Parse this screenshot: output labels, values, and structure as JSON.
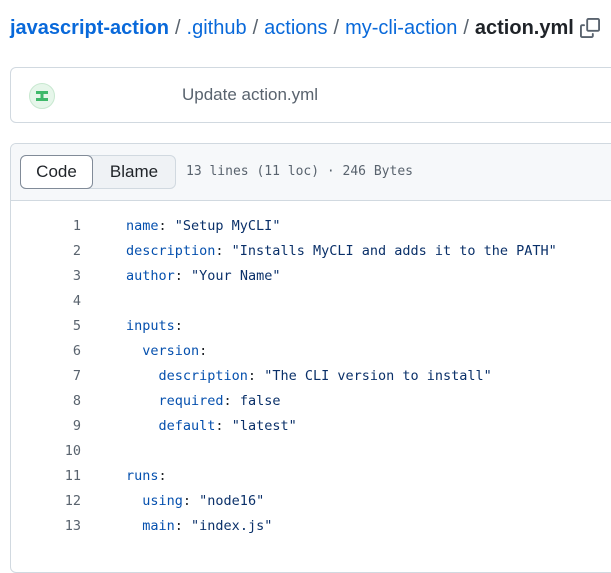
{
  "breadcrumb": {
    "repo": "javascript-action",
    "segments": [
      ".github",
      "actions",
      "my-cli-action"
    ],
    "separator": "/",
    "current_file": "action.yml"
  },
  "commit": {
    "message": "Update action.yml"
  },
  "file_header": {
    "tabs": [
      "Code",
      "Blame"
    ],
    "active_tab": "Code",
    "info": "13 lines (11 loc) · 246 Bytes"
  },
  "code_lines": [
    {
      "num": "1",
      "indent": "",
      "key": "name",
      "sep": ": ",
      "value": "\"Setup MyCLI\""
    },
    {
      "num": "2",
      "indent": "",
      "key": "description",
      "sep": ": ",
      "value": "\"Installs MyCLI and adds it to the PATH\""
    },
    {
      "num": "3",
      "indent": "",
      "key": "author",
      "sep": ": ",
      "value": "\"Your Name\""
    },
    {
      "num": "4",
      "indent": "",
      "key": "",
      "sep": "",
      "value": ""
    },
    {
      "num": "5",
      "indent": "",
      "key": "inputs",
      "sep": ":",
      "value": ""
    },
    {
      "num": "6",
      "indent": "  ",
      "key": "version",
      "sep": ":",
      "value": ""
    },
    {
      "num": "7",
      "indent": "    ",
      "key": "description",
      "sep": ": ",
      "value": "\"The CLI version to install\""
    },
    {
      "num": "8",
      "indent": "    ",
      "key": "required",
      "sep": ": ",
      "value": "false"
    },
    {
      "num": "9",
      "indent": "    ",
      "key": "default",
      "sep": ": ",
      "value": "\"latest\""
    },
    {
      "num": "10",
      "indent": "",
      "key": "",
      "sep": "",
      "value": ""
    },
    {
      "num": "11",
      "indent": "",
      "key": "runs",
      "sep": ":",
      "value": ""
    },
    {
      "num": "12",
      "indent": "  ",
      "key": "using",
      "sep": ": ",
      "value": "\"node16\""
    },
    {
      "num": "13",
      "indent": "  ",
      "key": "main",
      "sep": ": ",
      "value": "\"index.js\""
    }
  ],
  "colors": {
    "link": "#0969da",
    "yaml_key": "#0550ae",
    "yaml_string": "#0a3069",
    "muted": "#59636e"
  },
  "icons": {
    "copy": "copy-icon",
    "avatar": "identicon"
  }
}
